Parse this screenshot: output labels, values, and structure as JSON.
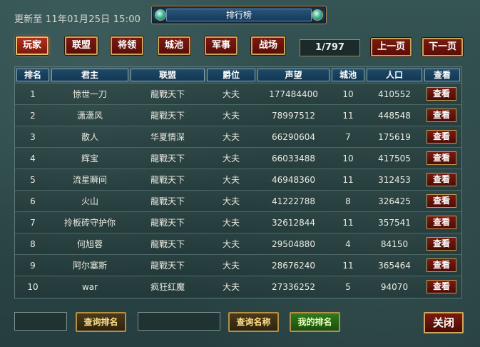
{
  "header": {
    "updated_label": "更新至 11年01月25日 15:00",
    "title": "排行榜"
  },
  "tabs": [
    {
      "label": "玩家",
      "active": true
    },
    {
      "label": "联盟",
      "active": false
    },
    {
      "label": "将领",
      "active": false
    },
    {
      "label": "城池",
      "active": false
    },
    {
      "label": "军事",
      "active": false
    },
    {
      "label": "战场",
      "active": false
    }
  ],
  "pager": {
    "indicator": "1/797",
    "prev_label": "上一页",
    "next_label": "下一页"
  },
  "table": {
    "columns": [
      "排名",
      "君主",
      "联盟",
      "爵位",
      "声望",
      "城池",
      "人口",
      "查看"
    ],
    "view_label": "查看",
    "rows": [
      {
        "rank": "1",
        "lord": "惊世一刀",
        "alliance": "龍戰天下",
        "title": "大夫",
        "prestige": "177484400",
        "cities": "10",
        "population": "410552"
      },
      {
        "rank": "2",
        "lord": "潇潇风",
        "alliance": "龍戰天下",
        "title": "大夫",
        "prestige": "78997512",
        "cities": "11",
        "population": "448548"
      },
      {
        "rank": "3",
        "lord": "散人",
        "alliance": "华夏情深",
        "title": "大夫",
        "prestige": "66290604",
        "cities": "7",
        "population": "175619"
      },
      {
        "rank": "4",
        "lord": "辉宝",
        "alliance": "龍戰天下",
        "title": "大夫",
        "prestige": "66033488",
        "cities": "10",
        "population": "417505"
      },
      {
        "rank": "5",
        "lord": "流星瞬间",
        "alliance": "龍戰天下",
        "title": "大夫",
        "prestige": "46948360",
        "cities": "11",
        "population": "312453"
      },
      {
        "rank": "6",
        "lord": "火山",
        "alliance": "龍戰天下",
        "title": "大夫",
        "prestige": "41222788",
        "cities": "8",
        "population": "326425"
      },
      {
        "rank": "7",
        "lord": "拎板砖守护你",
        "alliance": "龍戰天下",
        "title": "大夫",
        "prestige": "32612844",
        "cities": "11",
        "population": "357541"
      },
      {
        "rank": "8",
        "lord": "何旭蓉",
        "alliance": "龍戰天下",
        "title": "大夫",
        "prestige": "29504880",
        "cities": "4",
        "population": "84150"
      },
      {
        "rank": "9",
        "lord": "阿尔塞斯",
        "alliance": "龍戰天下",
        "title": "大夫",
        "prestige": "28676240",
        "cities": "11",
        "population": "365464"
      },
      {
        "rank": "10",
        "lord": "war",
        "alliance": "疯狂红魔",
        "title": "大夫",
        "prestige": "27336252",
        "cities": "5",
        "population": "94070"
      }
    ]
  },
  "footer": {
    "rank_input_value": "",
    "query_rank_label": "查询排名",
    "name_input_value": "",
    "query_name_label": "查询名称",
    "my_rank_label": "我的排名",
    "close_label": "关闭"
  }
}
